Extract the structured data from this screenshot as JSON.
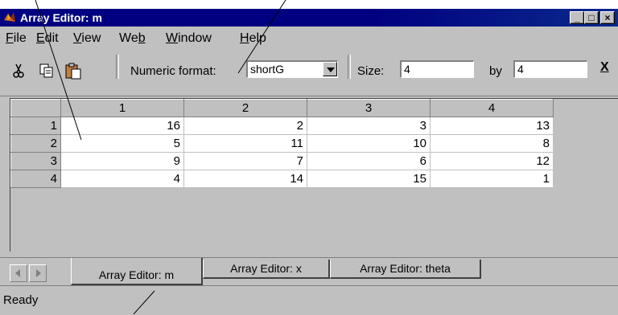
{
  "window": {
    "title": "Array Editor: m"
  },
  "menu": [
    {
      "pre": "",
      "key": "F",
      "post": "ile"
    },
    {
      "pre": "",
      "key": "E",
      "post": "dit"
    },
    {
      "pre": "",
      "key": "V",
      "post": "iew"
    },
    {
      "pre": "We",
      "key": "b",
      "post": ""
    },
    {
      "pre": "",
      "key": "W",
      "post": "indow"
    },
    {
      "pre": "",
      "key": "H",
      "post": "elp"
    }
  ],
  "toolbar": {
    "numeric_format_label": "Numeric format:",
    "numeric_format_value": "shortG",
    "size_label": "Size:",
    "rows_value": "4",
    "by_label": "by",
    "cols_value": "4",
    "close_label": "X"
  },
  "grid": {
    "col_headers": [
      "1",
      "2",
      "3",
      "4"
    ],
    "rows": [
      {
        "header": "1",
        "cells": [
          "16",
          "2",
          "3",
          "13"
        ]
      },
      {
        "header": "2",
        "cells": [
          "5",
          "11",
          "10",
          "8"
        ]
      },
      {
        "header": "3",
        "cells": [
          "9",
          "7",
          "6",
          "12"
        ]
      },
      {
        "header": "4",
        "cells": [
          "4",
          "14",
          "15",
          "1"
        ]
      }
    ]
  },
  "tabs": [
    "Array Editor: m",
    "Array Editor: x",
    "Array Editor: theta"
  ],
  "status": "Ready",
  "colors": {
    "titlebar": "#000080",
    "chrome": "#c0c0c0"
  }
}
